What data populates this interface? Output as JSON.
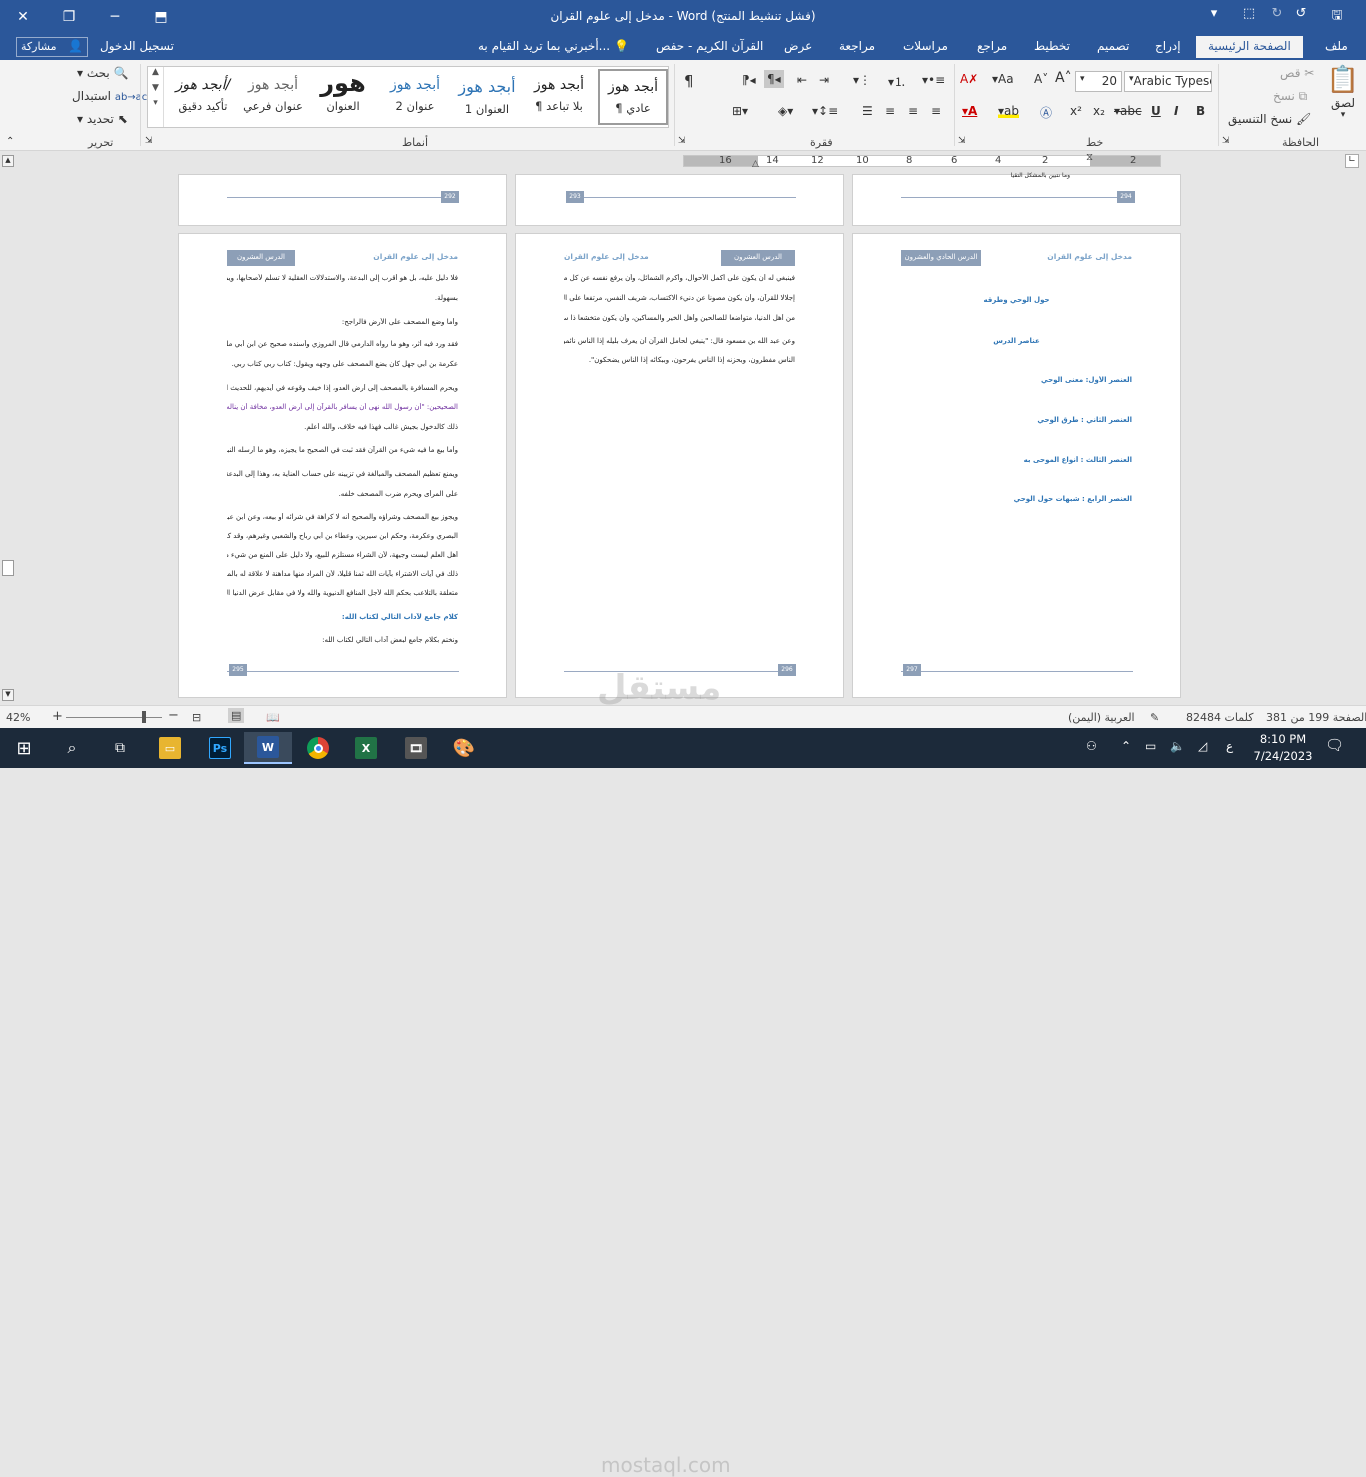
{
  "titlebar": {
    "title": "مدخل إلى علوم القران - Word (فشل تنشيط المنتج)",
    "save_icon": "save-icon",
    "undo_icon": "undo-icon",
    "redo_icon": "redo-icon"
  },
  "tabs": [
    {
      "label": "ملف"
    },
    {
      "label": "الصفحة الرئيسية"
    },
    {
      "label": "إدراج"
    },
    {
      "label": "تصميم"
    },
    {
      "label": "تخطيط"
    },
    {
      "label": "مراجع"
    },
    {
      "label": "مراسلات"
    },
    {
      "label": "مراجعة"
    },
    {
      "label": "عرض"
    },
    {
      "label": "القرآن الكريم - حفص"
    }
  ],
  "tell_me": "أخبرني بما تريد القيام به...",
  "sign_in": "تسجيل الدخول",
  "share": "مشاركة",
  "ribbon": {
    "clipboard": {
      "paste": "لصق",
      "cut": "قص",
      "copy": "نسخ",
      "format_painter": "نسخ التنسيق",
      "label": "الحافظة"
    },
    "font": {
      "family": "Arabic Typese",
      "size": "20",
      "label": "خط"
    },
    "paragraph": {
      "label": "فقرة"
    },
    "styles": {
      "label": "أنماط",
      "items": [
        {
          "preview": "أبجد هوز",
          "name": "¶ عادي"
        },
        {
          "preview": "أبجد هوز",
          "name": "¶ بلا تباعد"
        },
        {
          "preview": "أبجد هوز",
          "name": "العنوان 1"
        },
        {
          "preview": "أبجد هوز",
          "name": "عنوان 2"
        },
        {
          "preview": "هور",
          "name": "العنوان"
        },
        {
          "preview": "أبجد هوز",
          "name": "عنوان فرعي"
        },
        {
          "preview": "أبجد هوز/",
          "name": "تأكيد دقيق"
        }
      ]
    },
    "editing": {
      "find": "بحث",
      "replace": "استبدال",
      "select": "تحديد",
      "label": "تحرير"
    }
  },
  "ruler": {
    "numbers": [
      "2",
      "2",
      "4",
      "6",
      "8",
      "10",
      "12",
      "14",
      "16"
    ]
  },
  "pages_top": [
    {
      "num": "294"
    },
    {
      "num": "293"
    },
    {
      "num": "292"
    }
  ],
  "page_right": {
    "header_title": "مدخل إلى علوم القران",
    "badge": "الدرس الحادي والعشرون",
    "top_text": "وما نتبين بالمشكل التقيا",
    "lines": [
      "حول الوحي وطرقه",
      "عناصر الدرس",
      "العنصر الأول: معنى الوحي",
      "العنصر الثاني : طرق الوحي",
      "العنصر الثالث : أنواع الموحى به",
      "العنصر الرابع : شبهات حول الوحي"
    ],
    "num": "297"
  },
  "page_middle": {
    "header_title": "مدخل إلى علوم القران",
    "badge": "الدرس العشرون",
    "lines": [
      "فينبغي له أن يكون على أكمل الأحوال، وأكرم الشمائل، وأن يرفع نفسه عن كل ما نهى القرآن عنه",
      "إجلالا للقرآن، وأن يكون مصونا عن دنيء الاكتساب، شريف النفس، مرتفعا على الجبابرة والجفاة",
      "من أهل الدنيا، متواضعا للصالحين وأهل الخير والمساكين، وأن يكون متخشعا ذا سكينة.",
      "وعن عبد الله بن مسعود قال: \"ينبغي لحامل القرآن أن يعرف بليله إذا الناس نائمون، وبنهاره إذا",
      "الناس مفطرون، وبحزنه إذا الناس يفرحون، وببكائه إذا الناس يضحكون\"."
    ],
    "num": "296"
  },
  "page_left": {
    "header_title": "مدخل إلى علوم القران",
    "badge": "الدرس العشرون",
    "lines": [
      "فلا دليل عليه، بل هو أقرب إلى البدعة، والاستدلالات العقلية لا تسلم لأصحابها، ويمكن ردها",
      "بسهولة.",
      "وأما وضع المصحف على الأرض فالراجح:",
      "فقد ورد فيه أثر، وهو ما رواه الدارمي قال المروزي وأسنده صحيح عن ابن أبي مليكة : أن",
      "عكرمة بن أبي جهل كان يضع المصحف على وجهه ويقول: كتاب ربي كتاب ربي.",
      "ويحرم المسافرة بالمصحف إلى أرض العدو، إذا خيف وقوعه في أيديهم، للحديث المشهور في",
      "الصحيحين: \"أن رسول الله نهى أن يسافر بالقرآن إلى أرض العدو، مخافة أن يناله\"، أما إذا أمن",
      "ذلك كالدخول بجيش غالب فهذا فيه خلاف، والله أعلم.",
      "وأما بيع ما فيه شيء من القرآن فقد ثبت في الصحيح ما يجيزه، وهو ما أرسله النبي إلى هرقل.",
      "ويمنع تعظيم المصحف والمبالغة في تزيينه على حساب العناية به، وهذا إلى البدعة أقرب، والله أعلم",
      "على المرأى ويحرم ضرب المصحف خلفه.",
      "ويجوز بيع المصحف وشراؤه والصحيح أنه لا كراهة في شرائه أو بيعه، وعن ابن عباس: الحسن",
      "البصري وعكرمة، وحكم ابن سيرين، وعطاء بن أبي رباح والشعبي وغيرهم، وقد كرهه بعض",
      "أهل العلم ليست وجيهة، لأن الشراء مستلزم للبيع، ولا دليل على المنع من شيء منهما، ولا دخل",
      "ذلك في آيات الاشتراء بآيات الله ثمنا قليلا، لأن المراد منها مداهنة لا علاقة له بالمصحف، وإنما",
      "متعلقة بالتلاعب بحكم الله لأجل المنافع الدنيوية والله ولا في مقابل عرض الدنيا الزائل من جاه وغيره.",
      "كلام جامع لآداب التالي لكتاب الله:",
      "ونختم بكلام جامع لبعض آداب التالي لكتاب الله:"
    ],
    "num": "295"
  },
  "status": {
    "page": "الصفحة 199 من 381",
    "words": "82484 كلمات",
    "language": "العربية (اليمن)",
    "zoom": "42%"
  },
  "taskbar": {
    "time": "8:10 PM",
    "date": "7/24/2023",
    "ime": "ع"
  },
  "watermark": {
    "brand": "مستقل",
    "url": "mostaql.com"
  }
}
